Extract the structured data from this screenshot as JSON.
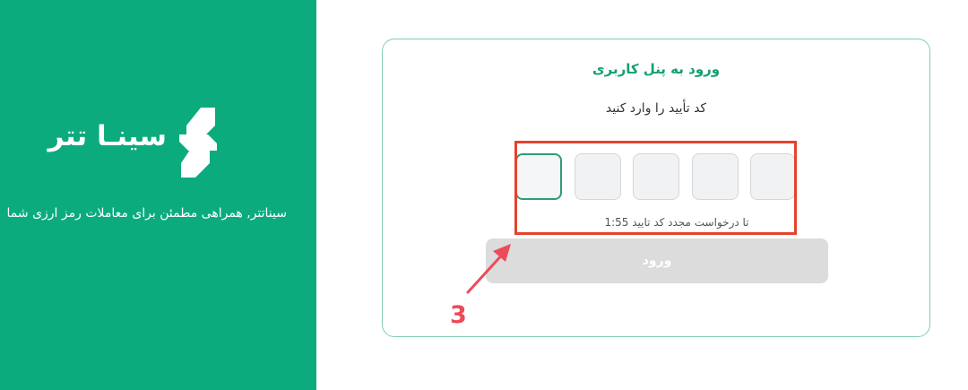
{
  "brand": {
    "name": "سینـا تتر",
    "tagline": "سیناتتر, همراهی مطمئن برای معاملات رمز ارزی شما",
    "color": "#0bab7e"
  },
  "login_card": {
    "title": "ورود به پنل کاربری",
    "subtitle": "کد تأیید را وارد کنید",
    "otp_count": 5,
    "resend_label": "تا درخواست مجدد کد تایید",
    "resend_timer": "1:55",
    "submit_label": "ورود"
  },
  "annotation": {
    "step_number": "3",
    "highlight_color": "#e4432c",
    "arrow_color": "#ee4a5a"
  }
}
